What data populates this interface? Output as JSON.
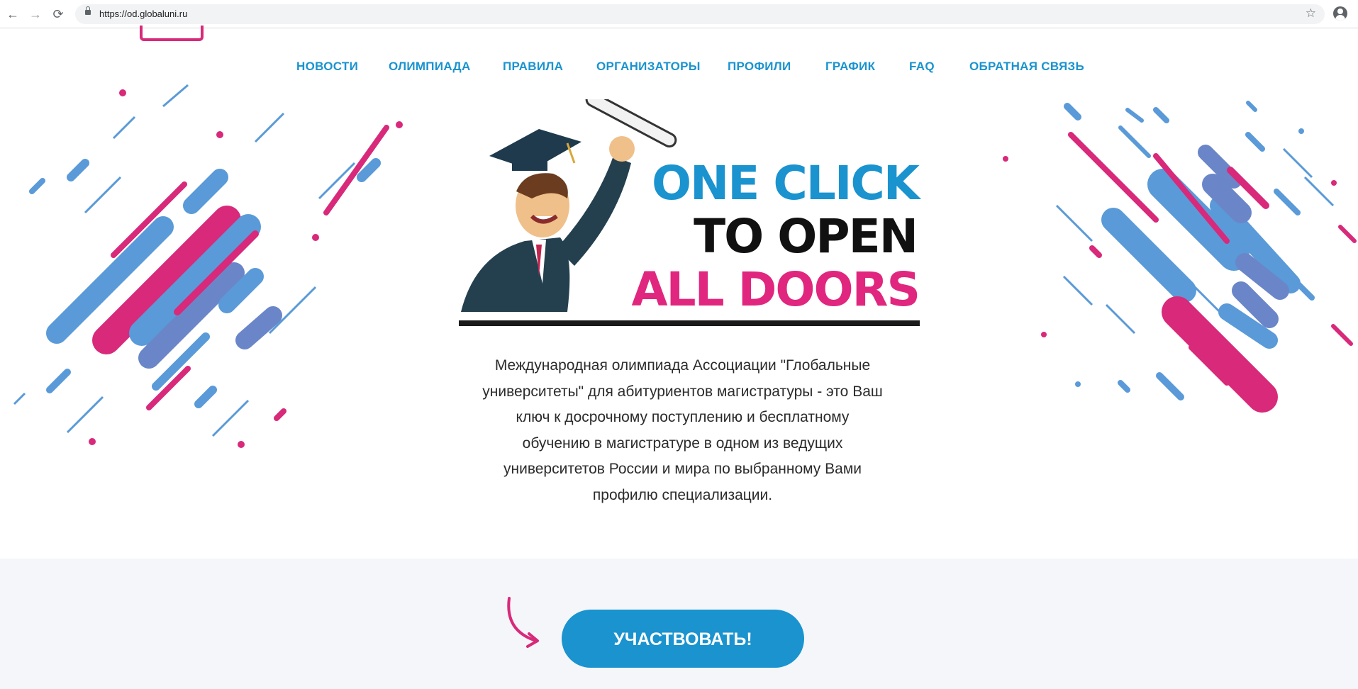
{
  "browser": {
    "url": "https://od.globaluni.ru",
    "back_icon": "←",
    "forward_icon": "→",
    "reload_icon": "⟳",
    "star_icon": "☆"
  },
  "nav": {
    "items": [
      "НОВОСТИ",
      "ОЛИМПИАДА",
      "ПРАВИЛА",
      "ОРГАНИЗАТОРЫ",
      "ПРОФИЛИ",
      "ГРАФИК",
      "FAQ",
      "ОБРАТНАЯ СВЯЗЬ"
    ]
  },
  "hero": {
    "line1": "ONE CLICK",
    "line2": "TO OPEN",
    "line3": "ALL DOORS"
  },
  "description": "Международная олимпиада Ассоциации \"Глобальные университеты\" для абитуриентов магистратуры - это Ваш ключ к досрочному поступлению и бесплатному обучению в магистратуре в одном из ведущих университетов России и мира по выбранному Вами профилю специализации.",
  "cta": {
    "label": "УЧАСТВОВАТЬ!"
  },
  "colors": {
    "blue": "#1a93cf",
    "pink": "#e0267e",
    "dark": "#111111"
  }
}
